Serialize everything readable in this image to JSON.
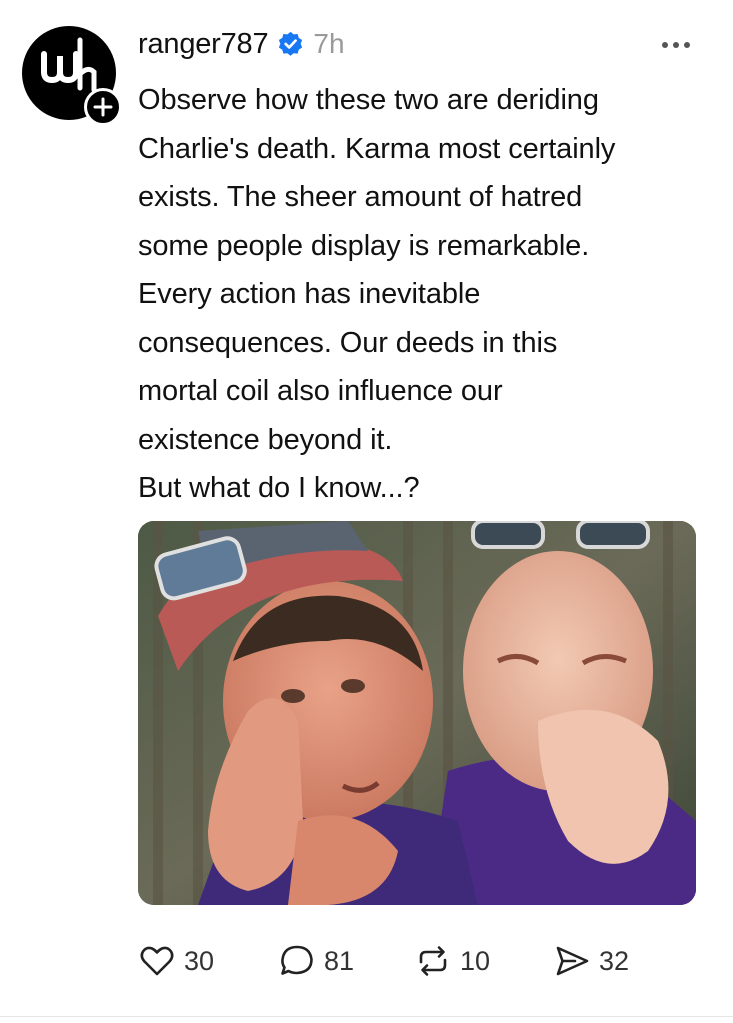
{
  "post": {
    "username": "ranger787",
    "verified": true,
    "timestamp": "7h",
    "text": "Observe how these two are deriding\nCharlie's death. Karma most certainly\nexists. The sheer amount of hatred\nsome people display is remarkable.\nEvery action has inevitable\nconsequences. Our deeds in this\nmortal coil also influence our\nexistence beyond it.\nBut what do I know...?"
  },
  "avatar": {
    "icon": "wh-logo-avatar",
    "badge_icon": "plus-icon"
  },
  "actions": {
    "likes": "30",
    "replies": "81",
    "reposts": "10",
    "shares": "32"
  },
  "colors": {
    "verified_blue": "#1877f2",
    "text": "#111111",
    "muted": "#9a9a9a"
  }
}
